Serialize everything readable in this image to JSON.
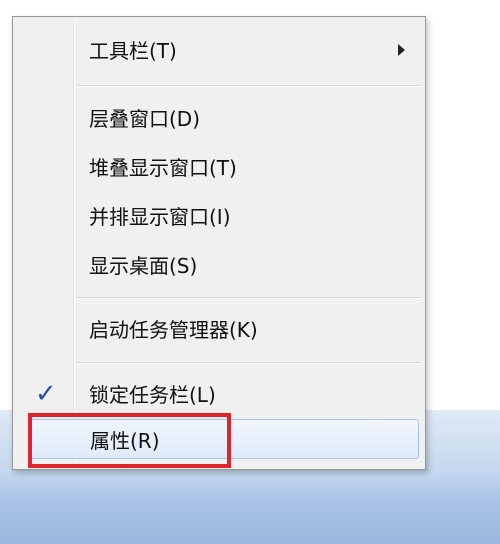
{
  "context_menu": {
    "items": [
      {
        "label": "工具栏(T)",
        "submenu": true
      },
      {
        "label": "层叠窗口(D)"
      },
      {
        "label": "堆叠显示窗口(T)"
      },
      {
        "label": "并排显示窗口(I)"
      },
      {
        "label": "显示桌面(S)"
      },
      {
        "label": "启动任务管理器(K)"
      },
      {
        "label": "锁定任务栏(L)",
        "checked": true,
        "check_glyph": "✓"
      },
      {
        "label": "属性(R)",
        "hovered": true
      }
    ]
  },
  "colors": {
    "annotation_box": "#e0242c",
    "check_mark": "#1f4fa8",
    "menu_background": "#f0f0f0",
    "taskbar": "#a9c4e6"
  }
}
